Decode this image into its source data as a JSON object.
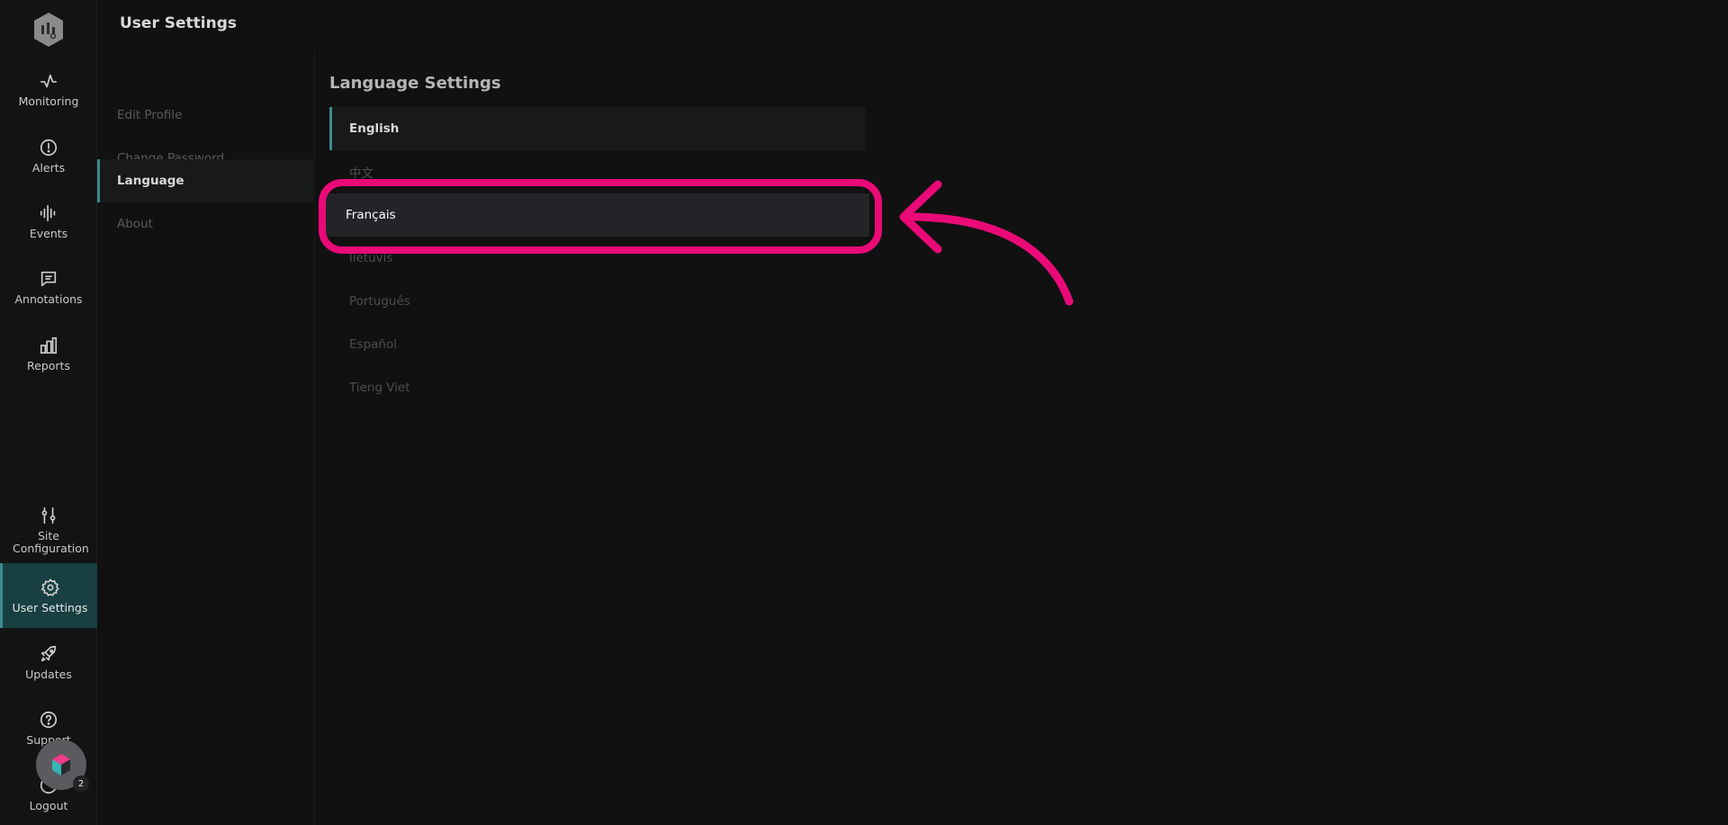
{
  "header": {
    "title": "User Settings"
  },
  "sidebar": {
    "items": [
      {
        "label": "Monitoring",
        "icon": "activity-icon"
      },
      {
        "label": "Alerts",
        "icon": "alert-circle-icon"
      },
      {
        "label": "Events",
        "icon": "waveform-icon"
      },
      {
        "label": "Annotations",
        "icon": "message-square-icon"
      },
      {
        "label": "Reports",
        "icon": "bar-chart-icon"
      },
      {
        "label": "Site Configuration",
        "icon": "sliders-icon"
      },
      {
        "label": "User Settings",
        "icon": "gear-icon"
      },
      {
        "label": "Updates",
        "icon": "rocket-icon"
      },
      {
        "label": "Support",
        "icon": "help-circle-icon"
      },
      {
        "label": "Logout",
        "icon": "logout-icon"
      }
    ]
  },
  "submenu": {
    "items": [
      {
        "label": "Edit Profile"
      },
      {
        "label": "Change Password"
      },
      {
        "label": "Language"
      },
      {
        "label": "About"
      }
    ]
  },
  "language": {
    "title": "Language Settings",
    "options": [
      {
        "label": "English"
      },
      {
        "label": "中文"
      },
      {
        "label": "Français"
      },
      {
        "label": "lietuvis"
      },
      {
        "label": "Português"
      },
      {
        "label": "Español"
      },
      {
        "label": "Tieng Viet"
      }
    ]
  },
  "help_widget": {
    "badge_count": "2"
  },
  "colors": {
    "accent": "#3c8a8e",
    "active_nav_bg": "#183f42",
    "highlight": "#ea0a77",
    "background": "#111112"
  }
}
